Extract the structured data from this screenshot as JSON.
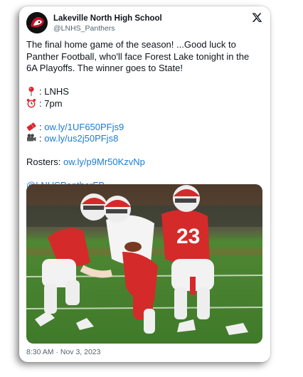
{
  "tweet": {
    "author_name": "Lakeville North High School",
    "author_handle": "@LNHS_Panthers",
    "text_line1": "The final home game of the season! ...Good luck to Panther Football, who'll face Forest Lake tonight in the 6A Playoffs. The winner goes to State!",
    "location_sep": ":",
    "location": "LNHS",
    "time_sep": ":",
    "time": "7pm",
    "ticket_sep": ":",
    "ticket_link": "ow.ly/1UF650PFjs9",
    "video_sep": ":",
    "video_link": "ow.ly/us2j50PFjs8",
    "rosters_label": "Rosters:",
    "rosters_link": "ow.ly/p9Mr50KzvNp",
    "mention": "@LNHSPantherFB",
    "timestamp": "8:30 AM · Nov 3, 2023"
  },
  "photo": {
    "jersey_number": "23"
  },
  "icons": {
    "x_logo": "x-logo-icon",
    "location": "round-pushpin-icon",
    "time": "alarm-clock-icon",
    "ticket": "ticket-icon",
    "video": "movie-camera-icon"
  },
  "colors": {
    "link": "#1d7bd1",
    "jersey_red": "#d42a2a",
    "turf": "#4e8a34"
  }
}
